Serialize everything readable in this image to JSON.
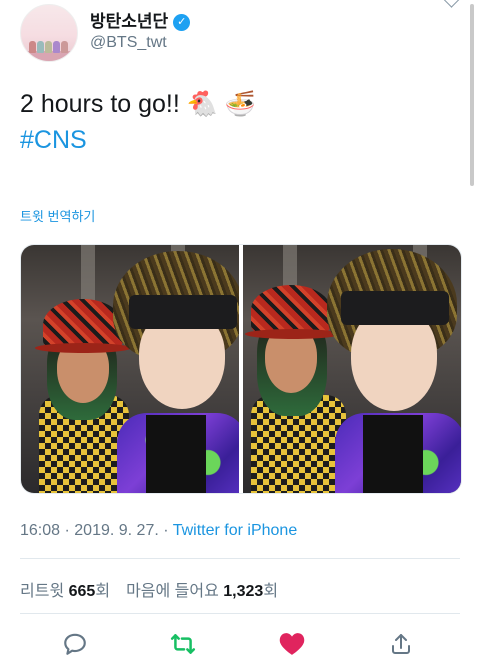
{
  "header": {
    "display_name": "방탄소년단",
    "handle": "@BTS_twt",
    "verified_icon": "verified-badge-icon"
  },
  "tweet": {
    "text": "2 hours to go!! 🐔 🍜",
    "hashtag": "#CNS",
    "translate_label": "트윗 번역하기"
  },
  "meta": {
    "time": "16:08",
    "sep1": " · ",
    "date": "2019. 9. 27.",
    "sep2": " · ",
    "source": "Twitter for iPhone"
  },
  "stats": {
    "retweets_label": "리트윗",
    "retweets_count": "665",
    "retweets_suffix": "회",
    "likes_label": "마음에 들어요",
    "likes_count": "1,323",
    "likes_suffix": "회"
  },
  "actions": [
    {
      "icon": "reply-icon",
      "color": "#657786"
    },
    {
      "icon": "retweet-icon",
      "color": "#17bf63"
    },
    {
      "icon": "like-heart-icon",
      "color": "#e0245e"
    },
    {
      "icon": "share-icon",
      "color": "#657786"
    }
  ]
}
